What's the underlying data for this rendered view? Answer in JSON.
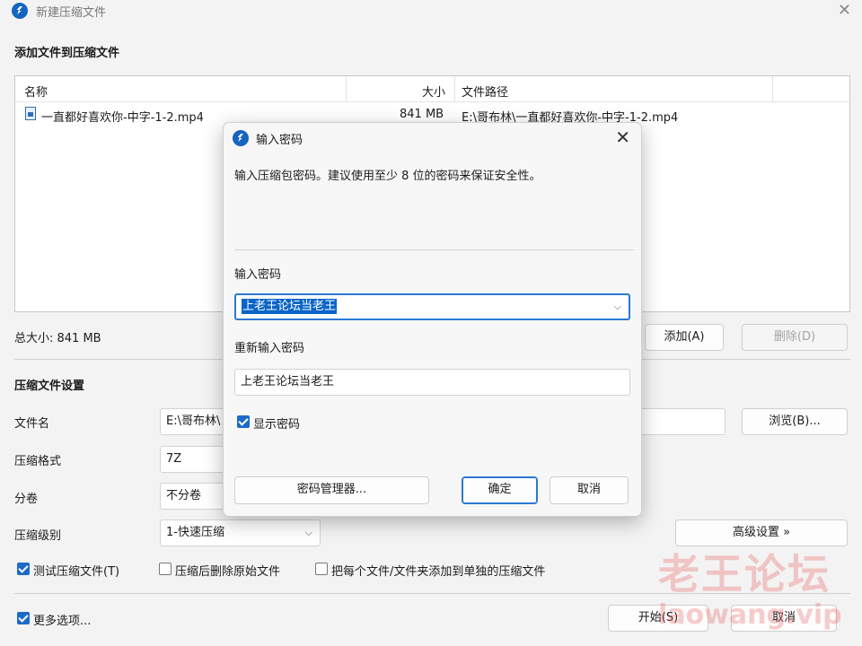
{
  "window": {
    "title": "新建压缩文件",
    "close": "✕"
  },
  "files_section": {
    "heading": "添加文件到压缩文件",
    "columns": [
      "名称",
      "大小",
      "文件路径"
    ],
    "rows": [
      {
        "name": "一直都好喜欢你-中字-1-2.mp4",
        "size": "841 MB",
        "path": "E:\\哥布林\\一直都好喜欢你-中字-1-2.mp4"
      }
    ],
    "total": "总大小: 841 MB",
    "add": "添加(A)",
    "delete": "删除(D)"
  },
  "settings": {
    "heading": "压缩文件设置",
    "filename_label": "文件名",
    "filename_value": "E:\\哥布林\\",
    "browse": "浏览(B)...",
    "format_label": "压缩格式",
    "format_value": "7Z",
    "split_label": "分卷",
    "split_value": "不分卷",
    "level_label": "压缩级别",
    "level_value": "1-快速压缩",
    "advanced": "高级设置 »",
    "opt_test": "测试压缩文件(T)",
    "opt_delete": "压缩后删除原始文件",
    "opt_each": "把每个文件/文件夹添加到单独的压缩文件",
    "more": "更多选项...",
    "start": "开始(S)",
    "cancel": "取消"
  },
  "checks": {
    "test": true,
    "delete": false,
    "each": false,
    "more": true
  },
  "watermark": {
    "cn": "老王论坛",
    "en": "laowang.vip"
  },
  "dialog": {
    "title": "输入密码",
    "desc": "输入压缩包密码。建议使用至少 8 位的密码来保证安全性。",
    "pwd_label": "输入密码",
    "pwd_value": "上老王论坛当老王",
    "repeat_label": "重新输入密码",
    "repeat_value": "上老王论坛当老王",
    "show_pwd": "显示密码",
    "show_pwd_checked": true,
    "manager": "密码管理器...",
    "ok": "确定",
    "cancel": "取消"
  },
  "colors": {
    "accent": "#1d6ac8",
    "selection": "#0a64c8",
    "watermark": "#eb6e6e"
  }
}
